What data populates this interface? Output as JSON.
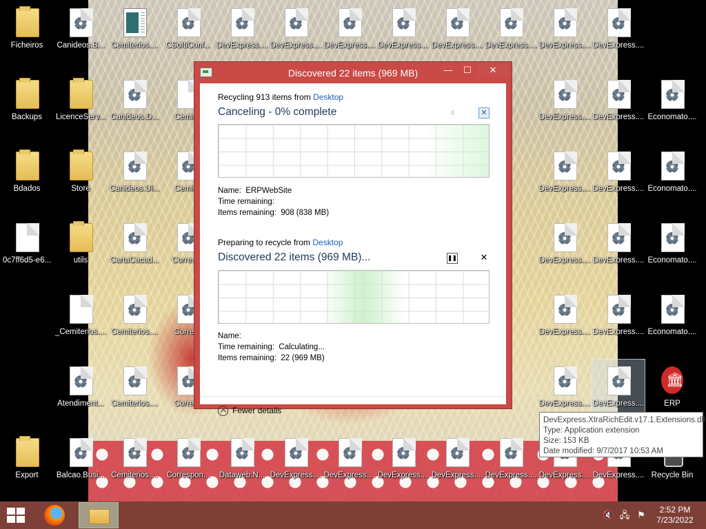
{
  "desktop": {
    "icons": [
      {
        "label": "Ficheiros",
        "type": "folder"
      },
      {
        "label": "Canideos.B...",
        "type": "dll"
      },
      {
        "label": "Cemiterios....",
        "type": "app"
      },
      {
        "label": "CSoftiConf...",
        "type": "dll"
      },
      {
        "label": "DevExpress....",
        "type": "dll"
      },
      {
        "label": "DevExpress....",
        "type": "dll"
      },
      {
        "label": "DevExpress....",
        "type": "dll"
      },
      {
        "label": "DevExpress....",
        "type": "dll"
      },
      {
        "label": "DevExpress....",
        "type": "dll"
      },
      {
        "label": "DevExpress....",
        "type": "dll"
      },
      {
        "label": "DevExpress....",
        "type": "dll"
      },
      {
        "label": "DevExpress....",
        "type": "dll"
      },
      {
        "label": "Backups",
        "type": "folder"
      },
      {
        "label": "LicenceServ...",
        "type": "folder"
      },
      {
        "label": "Canideos.D...",
        "type": "dll"
      },
      {
        "label": "Cemiter",
        "type": "file"
      },
      {
        "label": "DevExpress....",
        "type": "dll"
      },
      {
        "label": "DevExpress....",
        "type": "dll"
      },
      {
        "label": "Economato....",
        "type": "dll"
      },
      {
        "label": "Bdados",
        "type": "folder"
      },
      {
        "label": "Store",
        "type": "folder"
      },
      {
        "label": "Canideos.Ul...",
        "type": "dll"
      },
      {
        "label": "Cemiter",
        "type": "dll"
      },
      {
        "label": "DevExpress....",
        "type": "dll"
      },
      {
        "label": "DevExpress....",
        "type": "dll"
      },
      {
        "label": "Economato....",
        "type": "dll"
      },
      {
        "label": "0c7ff6d5-e6...",
        "type": "file"
      },
      {
        "label": "utils",
        "type": "folder"
      },
      {
        "label": "CartaCacad...",
        "type": "dll"
      },
      {
        "label": "Correspo",
        "type": "dll"
      },
      {
        "label": "DevExpress....",
        "type": "dll"
      },
      {
        "label": "DevExpress....",
        "type": "dll"
      },
      {
        "label": "Economato....",
        "type": "dll"
      },
      {
        "label": "_Cemiterios....",
        "type": "file"
      },
      {
        "label": "Cemiterios....",
        "type": "dll"
      },
      {
        "label": "Corresp",
        "type": "dll"
      },
      {
        "label": "DevExpress....",
        "type": "dll"
      },
      {
        "label": "DevExpress....",
        "type": "dll"
      },
      {
        "label": "Economato....",
        "type": "dll"
      },
      {
        "label": "Atendiment...",
        "type": "dll"
      },
      {
        "label": "Cemiterios....",
        "type": "dll"
      },
      {
        "label": "Corresp",
        "type": "dll"
      },
      {
        "label": "DevExpress....",
        "type": "dll"
      },
      {
        "label": "DevExpress....",
        "type": "dll"
      },
      {
        "label": "ERP",
        "type": "erp"
      },
      {
        "label": "Export",
        "type": "folder"
      },
      {
        "label": "Balcao.Busi...",
        "type": "dll"
      },
      {
        "label": "Cemiterios....",
        "type": "dll"
      },
      {
        "label": "Correspon...",
        "type": "dll"
      },
      {
        "label": "Dataweb.N...",
        "type": "dll"
      },
      {
        "label": "DevExpress....",
        "type": "dll"
      },
      {
        "label": "DevExpress....",
        "type": "dll"
      },
      {
        "label": "DevExpress....",
        "type": "dll"
      },
      {
        "label": "DevExpress....",
        "type": "dll"
      },
      {
        "label": "DevExpress....",
        "type": "dll"
      },
      {
        "label": "DevExpress....",
        "type": "dll"
      },
      {
        "label": "DevExpress....",
        "type": "dll"
      },
      {
        "label": "Recycle Bin",
        "type": "bin"
      }
    ]
  },
  "dialog": {
    "title": "Discovered 22 items (969 MB)",
    "title_buttons": {
      "minimize": "—",
      "maximize": "☐",
      "close": "✕"
    },
    "op1": {
      "subtitle_prefix": "Recycling 913 items from ",
      "subtitle_link": "Desktop",
      "status": "Canceling - 0% complete",
      "pause_symbol": "॥",
      "cancel_symbol": "✕",
      "name_label": "Name:",
      "name_value": "ERPWebSite",
      "time_label": "Time remaining:",
      "time_value": "",
      "items_label": "Items remaining:",
      "items_value": "908 (838 MB)"
    },
    "op2": {
      "subtitle_prefix": "Preparing to recycle from ",
      "subtitle_link": "Desktop",
      "status": "Discovered 22 items (969 MB)...",
      "pause_symbol": "❚❚",
      "cancel_symbol": "✕",
      "name_label": "Name:",
      "name_value": "",
      "time_label": "Time remaining:",
      "time_value": "Calculating...",
      "items_label": "Items remaining:",
      "items_value": "22 (969 MB)"
    },
    "fewer_details": "Fewer details"
  },
  "tooltip": {
    "filename": "DevExpress.XtraRichEdit.v17.1.Extensions.dll",
    "type": "Type: Application extension",
    "size": "Size: 153 KB",
    "modified": "Date modified: 9/7/2017 10:53 AM"
  },
  "taskbar": {
    "tray": {
      "volume": "🔇",
      "network": "🖧",
      "flag": "⚑"
    },
    "time": "2:52 PM",
    "date": "7/23/2022"
  },
  "colors": {
    "dialog_frame": "#c94a46",
    "link": "#1a5fb4",
    "status_text": "#1e3a5a",
    "taskbar": "#8c463c"
  }
}
